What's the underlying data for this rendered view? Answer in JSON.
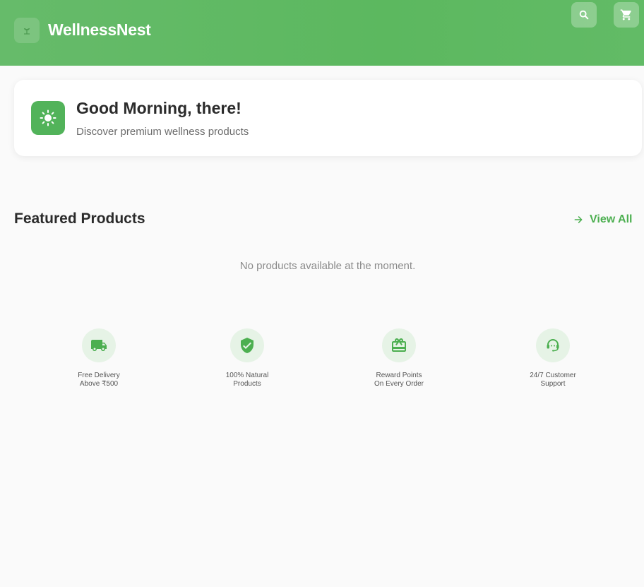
{
  "app": {
    "title": "WellnessNest"
  },
  "greeting": {
    "title": "Good Morning, there!",
    "subtitle": "Discover premium wellness products"
  },
  "featured": {
    "title": "Featured Products",
    "view_all_label": "View All",
    "empty_message": "No products available at the moment."
  },
  "features": [
    {
      "icon": "delivery-truck-icon",
      "line1": "Free Delivery",
      "line2": "Above ₹500"
    },
    {
      "icon": "verified-shield-icon",
      "line1": "100% Natural",
      "line2": "Products"
    },
    {
      "icon": "gift-card-icon",
      "line1": "Reward Points",
      "line2": "On Every Order"
    },
    {
      "icon": "support-agent-icon",
      "line1": "24/7 Customer",
      "line2": "Support"
    }
  ],
  "colors": {
    "brand_green": "#4caf50",
    "appbar_gradient_start": "#66bb6a",
    "feature_circle_bg": "#e6f3e6"
  }
}
